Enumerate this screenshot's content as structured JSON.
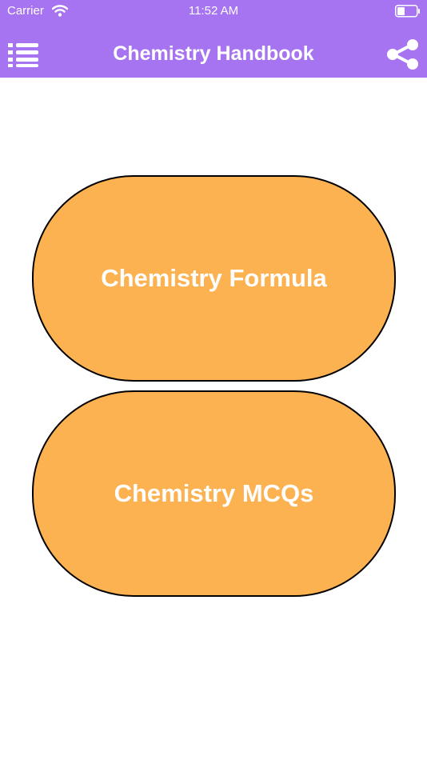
{
  "status_bar": {
    "carrier": "Carrier",
    "time": "11:52 AM",
    "wifi_icon": "wifi-icon",
    "battery_icon": "battery-icon"
  },
  "nav_bar": {
    "title": "Chemistry Handbook",
    "menu_icon": "menu-list-icon",
    "share_icon": "share-icon",
    "background_color": "#a673f1"
  },
  "main": {
    "buttons": [
      {
        "label": "Chemistry Formula"
      },
      {
        "label": "Chemistry MCQs"
      }
    ],
    "button_color": "#fdb252",
    "button_text_color": "#ffffff"
  }
}
